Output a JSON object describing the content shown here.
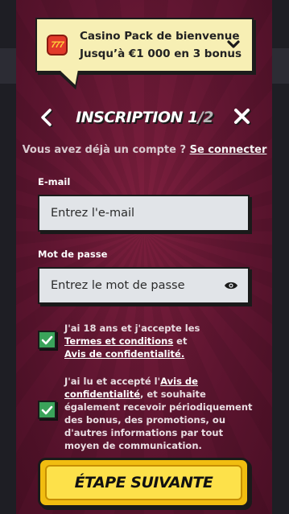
{
  "bonus": {
    "title": "Casino Pack de bienvenue",
    "subtitle": "Jusqu’à €1 000 en 3 bonus",
    "icon_glyph": "777"
  },
  "header": {
    "title_main": "INSCRIPTION 1",
    "title_slash": "/",
    "title_total": "2"
  },
  "login": {
    "prompt": "Vous avez déjà un compte ?",
    "link": "Se connecter"
  },
  "email": {
    "label": "E-mail",
    "placeholder": "Entrez l'e-mail",
    "value": ""
  },
  "password": {
    "label": "Mot de passe",
    "placeholder": "Entrez le mot de passe",
    "value": ""
  },
  "consent_terms": {
    "checked": true,
    "text_before": "J'ai 18 ans et j'accepte les",
    "terms_link": "Termes et conditions",
    "and": " et",
    "privacy_link": "Avis de confidentialité."
  },
  "consent_marketing": {
    "checked": true,
    "text_before": "J'ai lu et accepté l'",
    "privacy_link": "Avis de confidentialité",
    "text_after": ", et souhaite également recevoir périodiquement des bonus, des promotions, ou d'autres informations par tout moyen de communication."
  },
  "next_button": {
    "label": "ÉTAPE SUIVANTE"
  },
  "colors": {
    "panel": "#6a1934",
    "banner": "#f7efb4",
    "checkbox": "#3aa35a",
    "button": "#fde14a"
  }
}
